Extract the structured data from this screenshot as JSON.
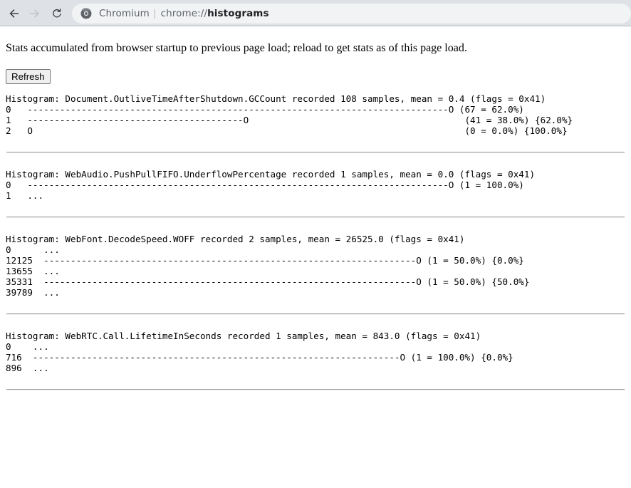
{
  "browser": {
    "back_icon": "back-arrow-icon",
    "forward_icon": "forward-arrow-icon",
    "reload_icon": "reload-icon",
    "site_icon": "chromium-logo-icon",
    "omnibox": {
      "site_name": "Chromium",
      "separator": "|",
      "url_scheme": "chrome://",
      "url_host": "histograms",
      "full_url": "chrome://histograms"
    }
  },
  "page": {
    "intro": "Stats accumulated from browser startup to previous page load; reload to get stats as of this page load.",
    "refresh_label": "Refresh",
    "histograms": [
      {
        "name": "Document.OutliveTimeAfterShutdown.GCCount",
        "header": "Histogram: Document.OutliveTimeAfterShutdown.GCCount recorded 108 samples, mean = 0.4 (flags = 0x41)",
        "body": "0   ------------------------------------------------------------------------------O (67 = 62.0%)\n1   ----------------------------------------O                                        (41 = 38.0%) {62.0%}\n2   O                                                                                (0 = 0.0%) {100.0%}"
      },
      {
        "name": "WebAudio.PushPullFIFO.UnderflowPercentage",
        "header": "Histogram: WebAudio.PushPullFIFO.UnderflowPercentage recorded 1 samples, mean = 0.0 (flags = 0x41)",
        "body": "0   ------------------------------------------------------------------------------O (1 = 100.0%)\n1   ..."
      },
      {
        "name": "WebFont.DecodeSpeed.WOFF",
        "header": "Histogram: WebFont.DecodeSpeed.WOFF recorded 2 samples, mean = 26525.0 (flags = 0x41)",
        "body": "0      ...\n12125  ---------------------------------------------------------------------O (1 = 50.0%) {0.0%}\n13655  ...\n35331  ---------------------------------------------------------------------O (1 = 50.0%) {50.0%}\n39789  ..."
      },
      {
        "name": "WebRTC.Call.LifetimeInSeconds",
        "header": "Histogram: WebRTC.Call.LifetimeInSeconds recorded 1 samples, mean = 843.0 (flags = 0x41)",
        "body": "0    ...\n716  --------------------------------------------------------------------O (1 = 100.0%) {0.0%}\n896  ..."
      }
    ]
  }
}
